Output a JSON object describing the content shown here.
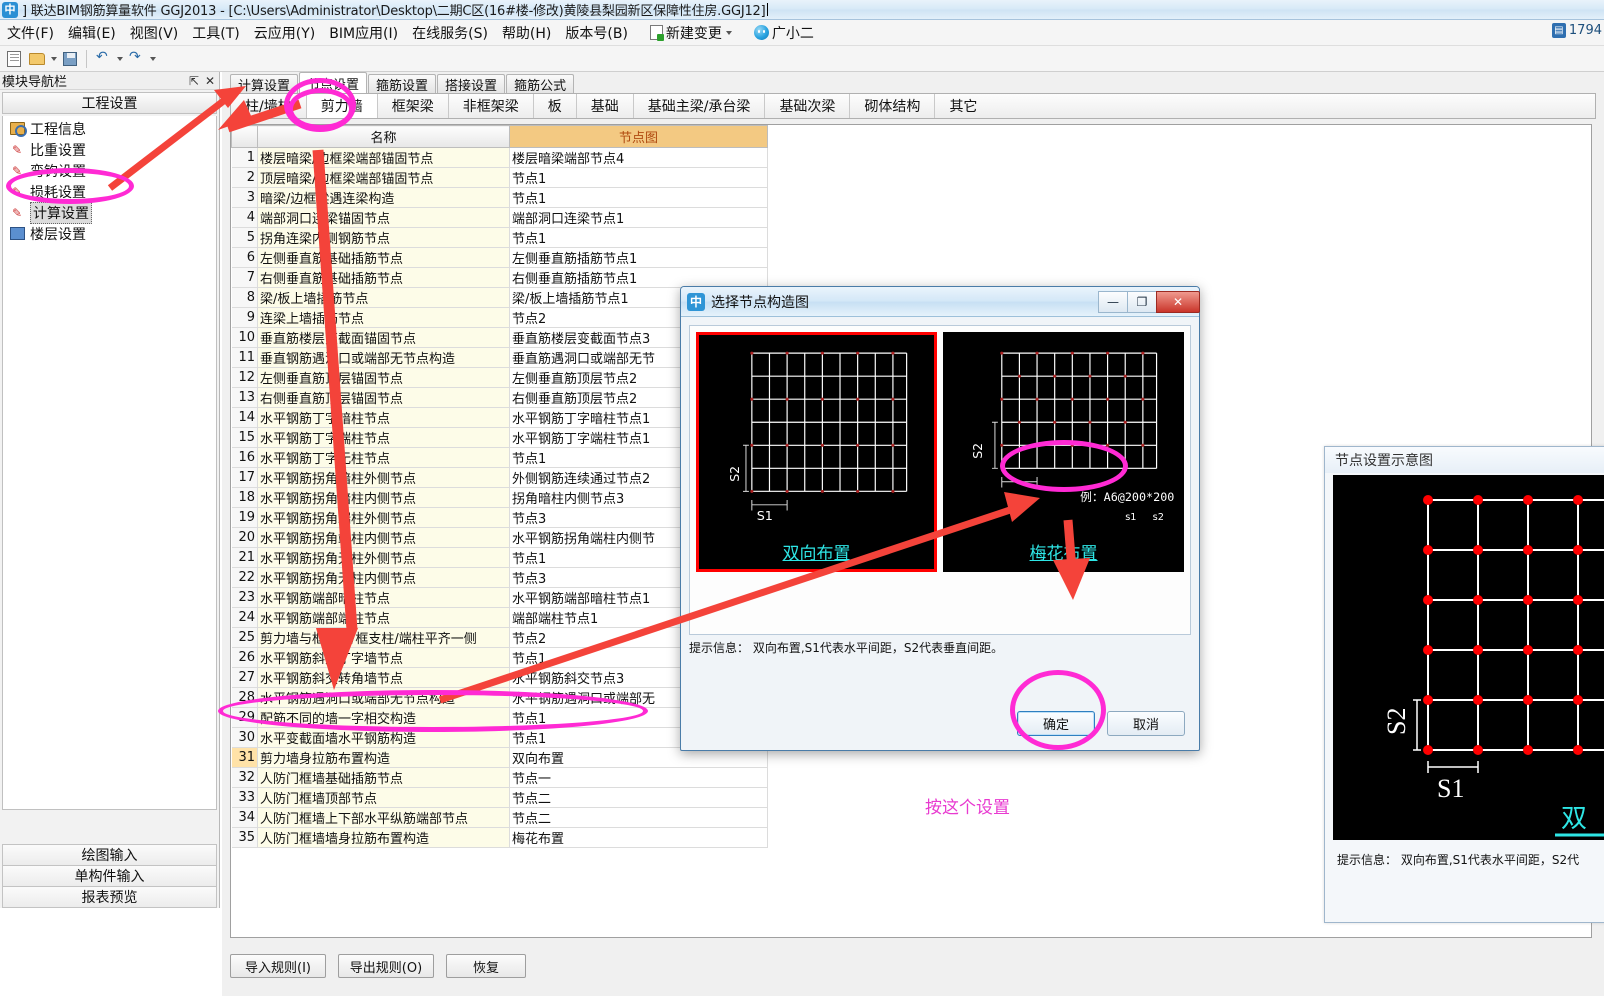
{
  "titlebar": {
    "icon": "app-icon",
    "text": "] 联达BIM钢筋算量软件 GGJ2013 - [C:\\Users\\Administrator\\Desktop\\二期C区(16#楼-修改)黄陵县梨园新区保障性住房.GGJ12]"
  },
  "menubar": {
    "items": [
      "文件(F)",
      "编辑(E)",
      "视图(V)",
      "工具(T)",
      "云应用(Y)",
      "BIM应用(I)",
      "在线服务(S)",
      "帮助(H)",
      "版本号(B)"
    ],
    "new_change": "新建变更",
    "user": "广小二",
    "right_count": "1794"
  },
  "sidebar": {
    "panel_title": "模块导航栏",
    "pin_icon": "pin-icon",
    "close_icon": "close-icon",
    "section_title": "工程设置",
    "items": [
      {
        "label": "工程信息",
        "icon": "project-info-icon"
      },
      {
        "label": "比重设置",
        "icon": "pencil-icon"
      },
      {
        "label": "弯钩设置",
        "icon": "pencil-icon"
      },
      {
        "label": "损耗设置",
        "icon": "pencil-icon"
      },
      {
        "label": "计算设置",
        "icon": "pencil-icon",
        "selected": true
      },
      {
        "label": "楼层设置",
        "icon": "layers-icon"
      }
    ],
    "bottom_buttons": [
      "绘图输入",
      "单构件输入",
      "报表预览"
    ]
  },
  "main": {
    "tabs_level1": [
      {
        "label": "计算设置",
        "active": false
      },
      {
        "label": "节点设置",
        "active": true
      },
      {
        "label": "箍筋设置",
        "active": false
      },
      {
        "label": "搭接设置",
        "active": false
      },
      {
        "label": "箍筋公式",
        "active": false
      }
    ],
    "tabs_level2": [
      {
        "label": "柱/墙柱",
        "active": false
      },
      {
        "label": "剪力墙",
        "active": true
      },
      {
        "label": "框架梁",
        "active": false
      },
      {
        "label": "非框架梁",
        "active": false
      },
      {
        "label": "板",
        "active": false
      },
      {
        "label": "基础",
        "active": false
      },
      {
        "label": "基础主梁/承台梁",
        "active": false
      },
      {
        "label": "基础次梁",
        "active": false
      },
      {
        "label": "砌体结构",
        "active": false
      },
      {
        "label": "其它",
        "active": false
      }
    ],
    "grid": {
      "headers": [
        "",
        "名称",
        "节点图"
      ],
      "rows": [
        {
          "idx": "1",
          "name": "楼层暗梁/边框梁端部锚固节点",
          "node": "楼层暗梁端部节点4"
        },
        {
          "idx": "2",
          "name": "顶层暗梁/边框梁端部锚固节点",
          "node": "节点1"
        },
        {
          "idx": "3",
          "name": "暗梁/边框梁遇连梁构造",
          "node": "节点1"
        },
        {
          "idx": "4",
          "name": "端部洞口连梁锚固节点",
          "node": "端部洞口连梁节点1"
        },
        {
          "idx": "5",
          "name": "拐角连梁内侧钢筋节点",
          "node": "节点1"
        },
        {
          "idx": "6",
          "name": "左侧垂直筋基础插筋节点",
          "node": "左侧垂直筋插筋节点1"
        },
        {
          "idx": "7",
          "name": "右侧垂直筋基础插筋节点",
          "node": "右侧垂直筋插筋节点1"
        },
        {
          "idx": "8",
          "name": "梁/板上墙插筋节点",
          "node": "梁/板上墙插筋节点1"
        },
        {
          "idx": "9",
          "name": "连梁上墙插筋节点",
          "node": "节点2"
        },
        {
          "idx": "10",
          "name": "垂直筋楼层变截面锚固节点",
          "node": "垂直筋楼层变截面节点3"
        },
        {
          "idx": "11",
          "name": "垂直钢筋遇洞口或端部无节点构造",
          "node": "垂直筋遇洞口或端部无节"
        },
        {
          "idx": "12",
          "name": "左侧垂直筋顶层锚固节点",
          "node": "左侧垂直筋顶层节点2"
        },
        {
          "idx": "13",
          "name": "右侧垂直筋顶层锚固节点",
          "node": "右侧垂直筋顶层节点2"
        },
        {
          "idx": "14",
          "name": "水平钢筋丁字暗柱节点",
          "node": "水平钢筋丁字暗柱节点1"
        },
        {
          "idx": "15",
          "name": "水平钢筋丁字端柱节点",
          "node": "水平钢筋丁字端柱节点1"
        },
        {
          "idx": "16",
          "name": "水平钢筋丁字无柱节点",
          "node": "节点1"
        },
        {
          "idx": "17",
          "name": "水平钢筋拐角暗柱外侧节点",
          "node": "外侧钢筋连续通过节点2"
        },
        {
          "idx": "18",
          "name": "水平钢筋拐角暗柱内侧节点",
          "node": "拐角暗柱内侧节点3"
        },
        {
          "idx": "19",
          "name": "水平钢筋拐角端柱外侧节点",
          "node": "节点3"
        },
        {
          "idx": "20",
          "name": "水平钢筋拐角端柱内侧节点",
          "node": "水平钢筋拐角端柱内侧节"
        },
        {
          "idx": "21",
          "name": "水平钢筋拐角无柱外侧节点",
          "node": "节点1"
        },
        {
          "idx": "22",
          "name": "水平钢筋拐角无柱内侧节点",
          "node": "节点3"
        },
        {
          "idx": "23",
          "name": "水平钢筋端部暗柱节点",
          "node": "水平钢筋端部暗柱节点1"
        },
        {
          "idx": "24",
          "name": "水平钢筋端部端柱节点",
          "node": "端部端柱节点1"
        },
        {
          "idx": "25",
          "name": "剪力墙与框架柱/框支柱/端柱平齐一侧",
          "node": "节点2"
        },
        {
          "idx": "26",
          "name": "水平钢筋斜交丁字墙节点",
          "node": "节点1"
        },
        {
          "idx": "27",
          "name": "水平钢筋斜交转角墙节点",
          "node": "水平钢筋斜交节点3"
        },
        {
          "idx": "28",
          "name": "水平钢筋遇洞口或端部无节点构造",
          "node": "水平钢筋遇洞口或端部无"
        },
        {
          "idx": "29",
          "name": "配筋不同的墙一字相交构造",
          "node": "节点1"
        },
        {
          "idx": "30",
          "name": "水平变截面墙水平钢筋构造",
          "node": "节点1"
        },
        {
          "idx": "31",
          "name": "剪力墙身拉筋布置构造",
          "node": "双向布置",
          "selected": true
        },
        {
          "idx": "32",
          "name": "人防门框墙基础插筋节点",
          "node": "节点一"
        },
        {
          "idx": "33",
          "name": "人防门框墙顶部节点",
          "node": "节点二"
        },
        {
          "idx": "34",
          "name": "人防门框墙上下部水平纵筋端部节点",
          "node": "节点二"
        },
        {
          "idx": "35",
          "name": "人防门框墙墙身拉筋布置构造",
          "node": "梅花布置"
        }
      ]
    },
    "bottom_buttons": [
      "导入规则(I)",
      "导出规则(O)",
      "恢复"
    ]
  },
  "dialog": {
    "icon": "app-icon",
    "title": "选择节点构造图",
    "window_buttons": {
      "minimize": "—",
      "maximize": "❐",
      "close": "✕"
    },
    "options": [
      {
        "label": "双向布置",
        "selected": true
      },
      {
        "label": "梅花布置",
        "selected": false,
        "note": "例：A6@200*200",
        "s1": "s1",
        "s2": "s2"
      }
    ],
    "diagram_labels": {
      "s1": "S1",
      "s2": "S2"
    },
    "hint": "提示信息： 双向布置,S1代表水平间距，S2代表垂直间距。",
    "buttons": {
      "ok": "确定",
      "cancel": "取消"
    }
  },
  "right_panel": {
    "title": "节点设置示意图",
    "diagram_labels": {
      "s1": "S1",
      "s2": "S2"
    },
    "caption": "双",
    "hint": "提示信息： 双向布置,S1代表水平间距，S2代"
  },
  "annotations": {
    "note_text": "按这个设置",
    "colors": {
      "magenta": "#ff2ad4",
      "red_arrow": "#f4433a",
      "note": "#e83ad0"
    }
  }
}
